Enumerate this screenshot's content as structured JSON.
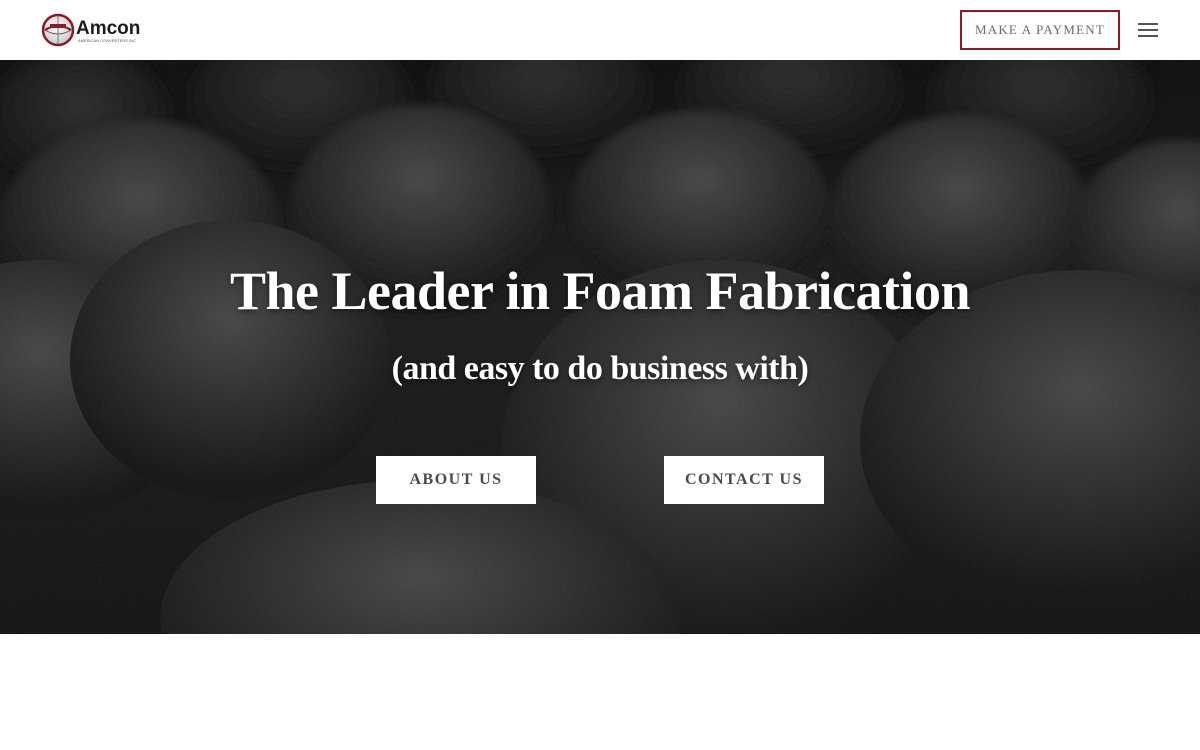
{
  "header": {
    "logo_text": "Amcon",
    "logo_tagline": "AMERICAN CONVERTERS INC",
    "pay_button": "MAKE A PAYMENT",
    "menu_icon": "hamburger-menu-icon"
  },
  "hero": {
    "title": "The Leader in Foam Fabrication",
    "subtitle": "(and easy to do business with)",
    "buttons": [
      {
        "label": "ABOUT US"
      },
      {
        "label": "CONTACT US"
      }
    ]
  },
  "colors": {
    "brand_red": "#8b1a24",
    "header_bg": "#ffffff",
    "hero_text": "#ffffff",
    "button_text": "#4a4a4a"
  }
}
